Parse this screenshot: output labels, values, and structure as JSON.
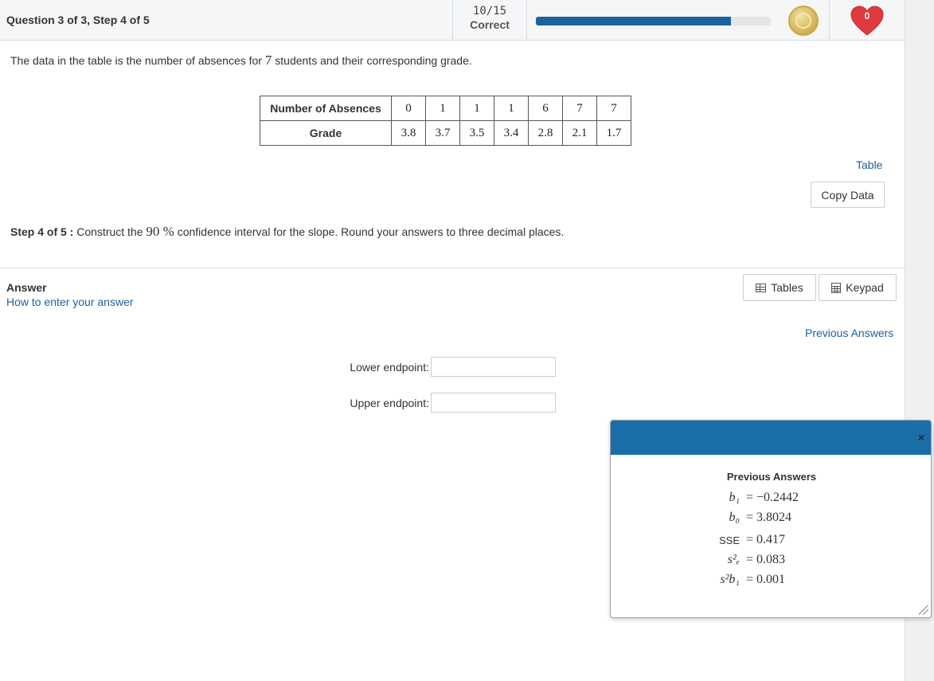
{
  "header": {
    "question_title": "Question 3 of 3, Step 4 of 5",
    "score": "10/15",
    "score_label": "Correct",
    "progress_fraction": 0.83,
    "hearts_count": "0"
  },
  "intro": {
    "before": "The data in the table is the number of absences for ",
    "count": "7",
    "after": " students and their corresponding grade."
  },
  "data_table": {
    "row1_header": "Number of Absences",
    "row1_values": [
      "0",
      "1",
      "1",
      "1",
      "6",
      "7",
      "7"
    ],
    "row2_header": "Grade",
    "row2_values": [
      "3.8",
      "3.7",
      "3.5",
      "3.4",
      "2.8",
      "2.1",
      "1.7"
    ]
  },
  "links": {
    "table": "Table",
    "copy_data": "Copy Data",
    "how_to": "How to enter your answer",
    "previous_answers": "Previous Answers"
  },
  "step": {
    "label": "Step 4 of 5 :",
    "before": " Construct the ",
    "percent": "90 %",
    "after": "  confidence interval for the slope. Round your answers to three decimal places."
  },
  "answer": {
    "label": "Answer",
    "tables_btn": "Tables",
    "keypad_btn": "Keypad",
    "lower_label": "Lower endpoint:",
    "lower_value": "",
    "upper_label": "Upper endpoint:",
    "upper_value": ""
  },
  "popup": {
    "title": "Previous Answers",
    "close": "×",
    "rows": [
      {
        "symbol": "b₁",
        "value": "= −0.2442"
      },
      {
        "symbol": "b₀",
        "value": "= 3.8024"
      },
      {
        "symbol": "SSE",
        "value": "= 0.417"
      },
      {
        "symbol": "s²ₑ",
        "value": "= 0.083"
      },
      {
        "symbol": "s²b₁",
        "value": "= 0.001"
      }
    ]
  },
  "colors": {
    "accent": "#1c62a0",
    "popup_header": "#1a6fa9",
    "heart": "#e0393e"
  }
}
